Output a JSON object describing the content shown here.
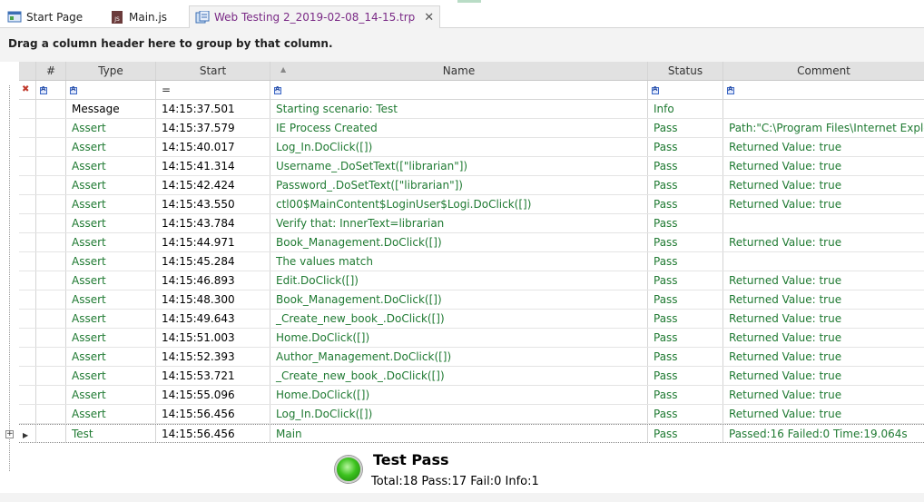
{
  "tabs": [
    {
      "label": "Start Page",
      "icon": "start-page-icon",
      "active": false
    },
    {
      "label": "Main.js",
      "icon": "js-file-icon",
      "active": false
    },
    {
      "label": "Web Testing 2_2019-02-08_14-15.trp",
      "icon": "report-file-icon",
      "active": true
    }
  ],
  "tab_close": "✕",
  "group_panel": "Drag a column header here to group by that column.",
  "columns": {
    "num": "#",
    "type": "Type",
    "start": "Start",
    "name": "Name",
    "status": "Status",
    "comment": "Comment"
  },
  "filter_row": {
    "start": "="
  },
  "rows": [
    {
      "type": "Message",
      "start": "14:15:37.501",
      "name": "Starting scenario: Test",
      "status": "Info",
      "comment": ""
    },
    {
      "type": "Assert",
      "start": "14:15:37.579",
      "name": "IE Process Created",
      "status": "Pass",
      "comment": "Path:\"C:\\Program Files\\Internet Explore"
    },
    {
      "type": "Assert",
      "start": "14:15:40.017",
      "name": "Log_In.DoClick([])",
      "status": "Pass",
      "comment": "Returned Value: true"
    },
    {
      "type": "Assert",
      "start": "14:15:41.314",
      "name": "Username_.DoSetText([\"librarian\"])",
      "status": "Pass",
      "comment": "Returned Value: true"
    },
    {
      "type": "Assert",
      "start": "14:15:42.424",
      "name": "Password_.DoSetText([\"librarian\"])",
      "status": "Pass",
      "comment": "Returned Value: true"
    },
    {
      "type": "Assert",
      "start": "14:15:43.550",
      "name": "ctl00$MainContent$LoginUser$Logi.DoClick([])",
      "status": "Pass",
      "comment": "Returned Value: true"
    },
    {
      "type": "Assert",
      "start": "14:15:43.784",
      "name": "Verify that: InnerText=librarian",
      "status": "Pass",
      "comment": ""
    },
    {
      "type": "Assert",
      "start": "14:15:44.971",
      "name": "Book_Management.DoClick([])",
      "status": "Pass",
      "comment": "Returned Value: true"
    },
    {
      "type": "Assert",
      "start": "14:15:45.284",
      "name": "The values match",
      "status": "Pass",
      "comment": ""
    },
    {
      "type": "Assert",
      "start": "14:15:46.893",
      "name": "Edit.DoClick([])",
      "status": "Pass",
      "comment": "Returned Value: true"
    },
    {
      "type": "Assert",
      "start": "14:15:48.300",
      "name": "Book_Management.DoClick([])",
      "status": "Pass",
      "comment": "Returned Value: true"
    },
    {
      "type": "Assert",
      "start": "14:15:49.643",
      "name": "_Create_new_book_.DoClick([])",
      "status": "Pass",
      "comment": "Returned Value: true"
    },
    {
      "type": "Assert",
      "start": "14:15:51.003",
      "name": "Home.DoClick([])",
      "status": "Pass",
      "comment": "Returned Value: true"
    },
    {
      "type": "Assert",
      "start": "14:15:52.393",
      "name": "Author_Management.DoClick([])",
      "status": "Pass",
      "comment": "Returned Value: true"
    },
    {
      "type": "Assert",
      "start": "14:15:53.721",
      "name": "_Create_new_book_.DoClick([])",
      "status": "Pass",
      "comment": "Returned Value: true"
    },
    {
      "type": "Assert",
      "start": "14:15:55.096",
      "name": "Home.DoClick([])",
      "status": "Pass",
      "comment": "Returned Value: true"
    },
    {
      "type": "Assert",
      "start": "14:15:56.456",
      "name": "Log_In.DoClick([])",
      "status": "Pass",
      "comment": "Returned Value: true"
    },
    {
      "type": "Test",
      "start": "14:15:56.456",
      "name": "Main",
      "status": "Pass",
      "comment": "Passed:16 Failed:0 Time:19.064s"
    }
  ],
  "summary": {
    "title": "Test Pass",
    "stats": "Total:18 Pass:17 Fail:0 Info:1"
  },
  "colors": {
    "pass_text": "#1f7a32",
    "active_tab_text": "#7a2a86",
    "header_bg": "#e1e1e1"
  }
}
